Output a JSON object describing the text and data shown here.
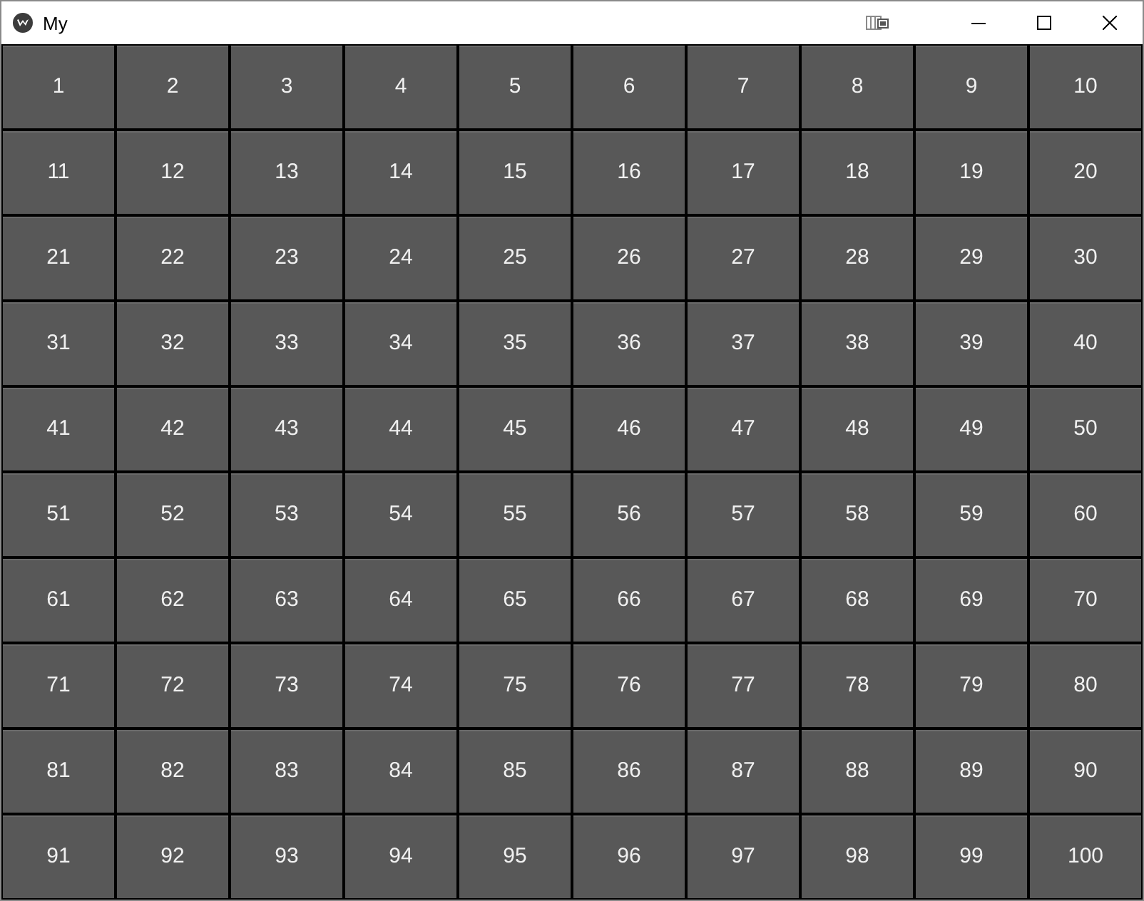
{
  "window": {
    "title": "My"
  },
  "buttons": [
    "1",
    "2",
    "3",
    "4",
    "5",
    "6",
    "7",
    "8",
    "9",
    "10",
    "11",
    "12",
    "13",
    "14",
    "15",
    "16",
    "17",
    "18",
    "19",
    "20",
    "21",
    "22",
    "23",
    "24",
    "25",
    "26",
    "27",
    "28",
    "29",
    "30",
    "31",
    "32",
    "33",
    "34",
    "35",
    "36",
    "37",
    "38",
    "39",
    "40",
    "41",
    "42",
    "43",
    "44",
    "45",
    "46",
    "47",
    "48",
    "49",
    "50",
    "51",
    "52",
    "53",
    "54",
    "55",
    "56",
    "57",
    "58",
    "59",
    "60",
    "61",
    "62",
    "63",
    "64",
    "65",
    "66",
    "67",
    "68",
    "69",
    "70",
    "71",
    "72",
    "73",
    "74",
    "75",
    "76",
    "77",
    "78",
    "79",
    "80",
    "81",
    "82",
    "83",
    "84",
    "85",
    "86",
    "87",
    "88",
    "89",
    "90",
    "91",
    "92",
    "93",
    "94",
    "95",
    "96",
    "97",
    "98",
    "99",
    "100"
  ]
}
